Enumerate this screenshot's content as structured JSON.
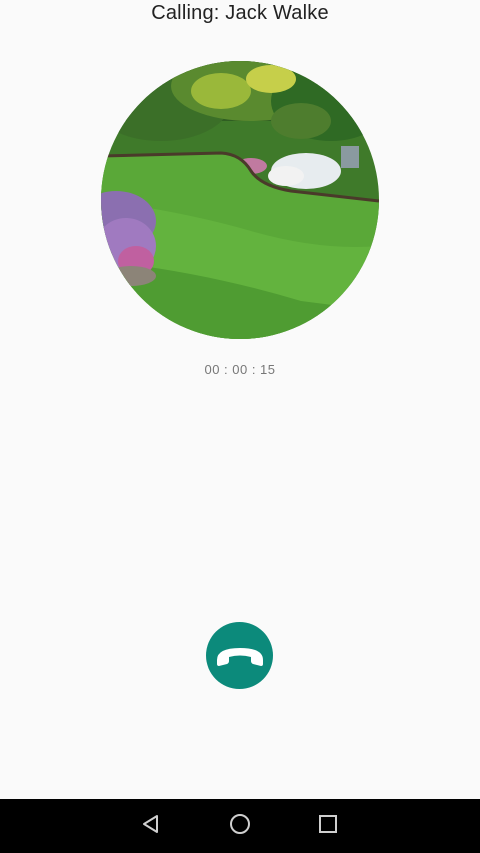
{
  "call": {
    "title": "Calling: Jack Walke",
    "duration": "00 : 00 : 15"
  },
  "colors": {
    "background": "#fafafa",
    "accent": "#0c8a7b",
    "navbar": "#000000"
  },
  "icons": {
    "hangup": "phone-hangup-icon",
    "back": "back-triangle-icon",
    "home": "home-circle-icon",
    "recent": "recent-apps-square-icon"
  }
}
